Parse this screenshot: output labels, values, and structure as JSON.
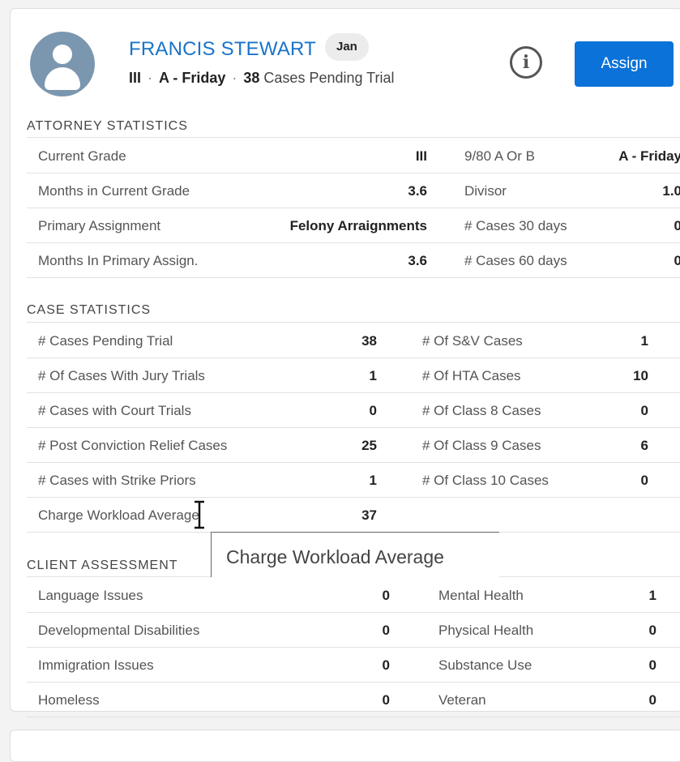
{
  "header": {
    "name": "FRANCIS STEWART",
    "badge": "Jan",
    "grade": "III",
    "day": "A - Friday",
    "cases_count": "38",
    "cases_label": "Cases Pending Trial",
    "info_icon": "i",
    "assign_label": "Assign"
  },
  "colors": {
    "accent": "#0a72d8",
    "name_link": "#1a73c9",
    "avatar_bg": "#7b97b0"
  },
  "attorney_statistics": {
    "title": "ATTORNEY STATISTICS",
    "rows": [
      {
        "l1": "Current Grade",
        "v1": "III",
        "l2": "9/80 A Or B",
        "v2": "A - Friday"
      },
      {
        "l1": "Months in Current Grade",
        "v1": "3.6",
        "l2": "Divisor",
        "v2": "1.0"
      },
      {
        "l1": "Primary Assignment",
        "v1": "Felony Arraignments",
        "l2": "# Cases 30 days",
        "v2": "0"
      },
      {
        "l1": "Months In Primary Assign.",
        "v1": "3.6",
        "l2": "# Cases 60 days",
        "v2": "0"
      }
    ]
  },
  "case_statistics": {
    "title": "CASE STATISTICS",
    "rows": [
      {
        "l1": "# Cases Pending Trial",
        "v1": "38",
        "l2": "# Of S&V Cases",
        "v2": "1"
      },
      {
        "l1": "# Of Cases With Jury Trials",
        "v1": "1",
        "l2": "# Of HTA Cases",
        "v2": "10"
      },
      {
        "l1": "# Cases with Court Trials",
        "v1": "0",
        "l2": "# Of Class 8 Cases",
        "v2": "0"
      },
      {
        "l1": "# Post Conviction Relief Cases",
        "v1": "25",
        "l2": "# Of Class 9 Cases",
        "v2": "6"
      },
      {
        "l1": "# Cases with Strike Priors",
        "v1": "1",
        "l2": "# Of Class 10 Cases",
        "v2": "0"
      },
      {
        "l1": "Charge Workload Average",
        "v1": "37",
        "l2": "",
        "v2": ""
      }
    ]
  },
  "client_assessment": {
    "title": "CLIENT ASSESSMENT",
    "rows": [
      {
        "l1": "Language Issues",
        "v1": "0",
        "l2": "Mental Health",
        "v2": "1"
      },
      {
        "l1": "Developmental Disabilities",
        "v1": "0",
        "l2": "Physical Health",
        "v2": "0"
      },
      {
        "l1": "Immigration Issues",
        "v1": "0",
        "l2": "Substance Use",
        "v2": "0"
      },
      {
        "l1": "Homeless",
        "v1": "0",
        "l2": "Veteran",
        "v2": "0"
      }
    ]
  },
  "tooltip": {
    "text": "Charge Workload Average"
  }
}
